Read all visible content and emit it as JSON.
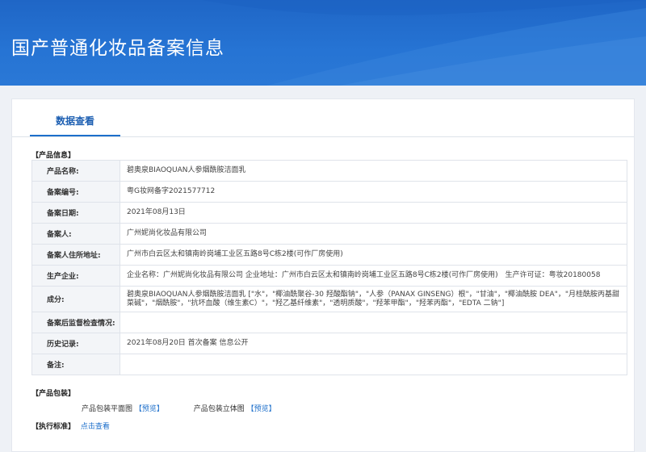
{
  "header": {
    "title": "国产普通化妆品备案信息"
  },
  "tab": {
    "label": "数据查看"
  },
  "product_info": {
    "section_title": "【产品信息】",
    "rows": [
      {
        "label": "产品名称:",
        "value": "碧奥泉BIAOQUAN人参烟酰胺洁面乳"
      },
      {
        "label": "备案编号:",
        "value": "粤G妆网备字2021577712"
      },
      {
        "label": "备案日期:",
        "value": "2021年08月13日"
      },
      {
        "label": "备案人:",
        "value": "广州妮尚化妆品有限公司"
      },
      {
        "label": "备案人住所地址:",
        "value": "广州市白云区太和镇南岭岗埔工业区五路8号C栋2楼(可作厂房使用)"
      },
      {
        "label": "生产企业:",
        "value": "企业名称：广州妮尚化妆品有限公司 企业地址：广州市白云区太和镇南岭岗埔工业区五路8号C栋2楼(可作厂房使用)　生产许可证：粤妆20180058"
      },
      {
        "label": "成分:",
        "value": "碧奥泉BIAOQUAN人参烟酰胺洁面乳 [\"水\"，\"椰油酰聚谷-30 羟酸酯钠\"，\"人参（PANAX GINSENG）根\"，\"甘油\"，\"椰油酰胺 DEA\"，\"月桂酰胺丙基甜菜碱\"，\"烟酰胺\"，\"抗坏血酸（维生素C）\"，\"羟乙基纤维素\"，\"透明质酸\"，\"羟苯甲酯\"，\"羟苯丙酯\"，\"EDTA 二钠\"]"
      },
      {
        "label": "备案后监督检查情况:",
        "value": ""
      },
      {
        "label": "历史记录:",
        "value": "2021年08月20日 首次备案 信息公开"
      },
      {
        "label": "备注:",
        "value": ""
      }
    ]
  },
  "packaging": {
    "section_title": "【产品包装】",
    "items": [
      {
        "label": "产品包装平面图",
        "link": "【预览】"
      },
      {
        "label": "产品包装立体图",
        "link": "【预览】"
      }
    ]
  },
  "standard": {
    "section_title": "【执行标准】",
    "link": "点击查看"
  },
  "colors": {
    "header_blue": "#2674d4",
    "link_blue": "#1d6fcb"
  }
}
